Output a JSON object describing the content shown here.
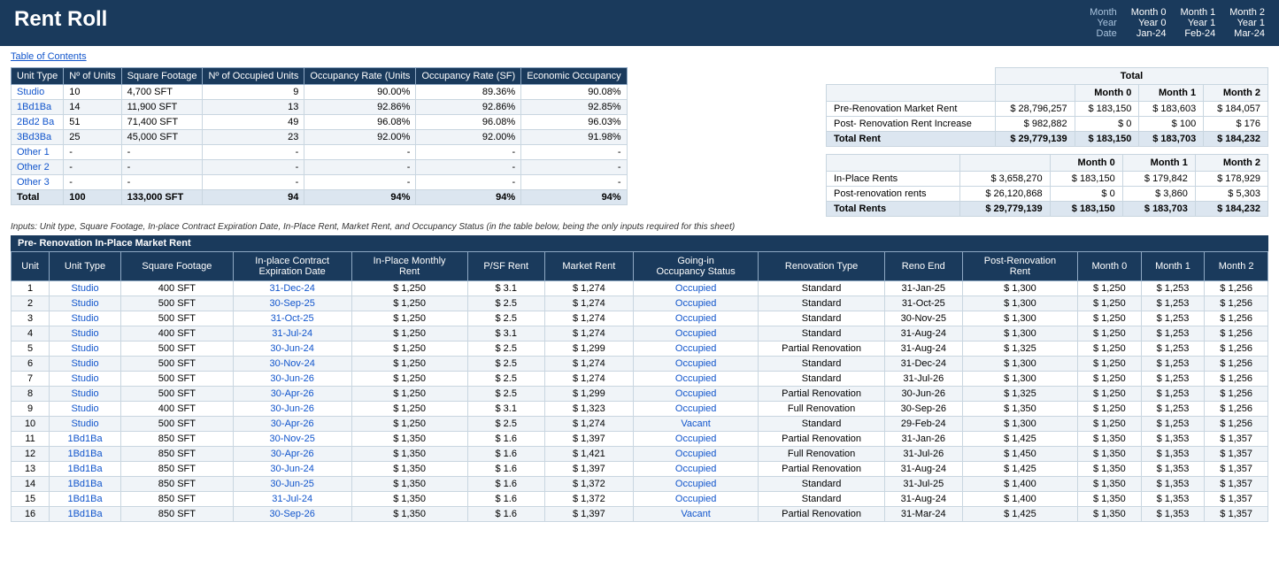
{
  "header": {
    "title": "Rent Roll",
    "col_labels": [
      "Month",
      "Month 0",
      "Month 1",
      "Month 2"
    ],
    "row_year_label": "Year",
    "row_year_vals": [
      "Year 0",
      "Year 1",
      "Year 1"
    ],
    "row_date_label": "Date",
    "row_date_vals": [
      "Jan-24",
      "Feb-24",
      "Mar-24"
    ]
  },
  "toc": "Table of Contents",
  "unit_table": {
    "headers": [
      "Unit Type",
      "Nº of Units",
      "Square Footage",
      "Nº of Occupied Units",
      "Occupancy Rate (Units",
      "Occupancy Rate (SF)",
      "Economic Occupancy"
    ],
    "rows": [
      [
        "Studio",
        "10",
        "4,700 SFT",
        "9",
        "90.00%",
        "89.36%",
        "90.08%"
      ],
      [
        "1Bd1Ba",
        "14",
        "11,900 SFT",
        "13",
        "92.86%",
        "92.86%",
        "92.85%"
      ],
      [
        "2Bd2 Ba",
        "51",
        "71,400 SFT",
        "49",
        "96.08%",
        "96.08%",
        "96.03%"
      ],
      [
        "3Bd3Ba",
        "25",
        "45,000 SFT",
        "23",
        "92.00%",
        "92.00%",
        "91.98%"
      ],
      [
        "Other 1",
        "-",
        "-",
        "-",
        "-",
        "-",
        "-"
      ],
      [
        "Other 2",
        "-",
        "-",
        "-",
        "-",
        "-",
        "-"
      ],
      [
        "Other 3",
        "-",
        "-",
        "-",
        "-",
        "-",
        "-"
      ],
      [
        "Total",
        "100",
        "133,000 SFT",
        "94",
        "94%",
        "94%",
        "94%"
      ]
    ]
  },
  "summary1": {
    "header_total": "Total",
    "col_headers": [
      "",
      "Month 0",
      "Month 1",
      "Month 2"
    ],
    "rows": [
      [
        "Pre-Renovation Market Rent",
        "$ 28,796,257",
        "$ 183,150",
        "$ 183,603",
        "$ 184,057"
      ],
      [
        "Post- Renovation Rent Increase",
        "$ 982,882",
        "$ 0",
        "$ 100",
        "$ 176"
      ],
      [
        "Total Rent",
        "$ 29,779,139",
        "$ 183,150",
        "$ 183,703",
        "$ 184,232"
      ]
    ],
    "total_row_index": 2
  },
  "summary2": {
    "col_headers": [
      "",
      "Month 0",
      "Month 1",
      "Month 2"
    ],
    "rows": [
      [
        "In-Place Rents",
        "$ 3,658,270",
        "$ 183,150",
        "$ 179,842",
        "$ 178,929"
      ],
      [
        "Post-renovation rents",
        "$ 26,120,868",
        "$ 0",
        "$ 3,860",
        "$ 5,303"
      ],
      [
        "Total Rents",
        "$ 29,779,139",
        "$ 183,150",
        "$ 183,703",
        "$ 184,232"
      ]
    ],
    "total_row_index": 2
  },
  "inputs_note": "Inputs: Unit type, Square Footage, In-place Contract Expiration Date, In-Place Rent, Market Rent, and Occupancy Status (in the table below, being the only inputs required for this sheet)",
  "section_label": "Pre- Renovation In-Place Market Rent",
  "detail_table": {
    "headers": [
      "Unit",
      "Unit Type",
      "Square Footage",
      "In-place Contract\nExpiration Date",
      "In-Place Monthly\nRent",
      "P/SF Rent",
      "Market Rent",
      "Going-in\nOccupancy Status",
      "Renovation Type",
      "Reno End",
      "Post-Renovation\nRent",
      "Month 0",
      "Month 1",
      "Month 2"
    ],
    "rows": [
      [
        "1",
        "Studio",
        "400 SFT",
        "31-Dec-24",
        "$ 1,250",
        "$ 3.1",
        "$ 1,274",
        "Occupied",
        "Standard",
        "31-Jan-25",
        "$ 1,300",
        "$ 1,250",
        "$ 1,253",
        "$ 1,256"
      ],
      [
        "2",
        "Studio",
        "500 SFT",
        "30-Sep-25",
        "$ 1,250",
        "$ 2.5",
        "$ 1,274",
        "Occupied",
        "Standard",
        "31-Oct-25",
        "$ 1,300",
        "$ 1,250",
        "$ 1,253",
        "$ 1,256"
      ],
      [
        "3",
        "Studio",
        "500 SFT",
        "31-Oct-25",
        "$ 1,250",
        "$ 2.5",
        "$ 1,274",
        "Occupied",
        "Standard",
        "30-Nov-25",
        "$ 1,300",
        "$ 1,250",
        "$ 1,253",
        "$ 1,256"
      ],
      [
        "4",
        "Studio",
        "400 SFT",
        "31-Jul-24",
        "$ 1,250",
        "$ 3.1",
        "$ 1,274",
        "Occupied",
        "Standard",
        "31-Aug-24",
        "$ 1,300",
        "$ 1,250",
        "$ 1,253",
        "$ 1,256"
      ],
      [
        "5",
        "Studio",
        "500 SFT",
        "30-Jun-24",
        "$ 1,250",
        "$ 2.5",
        "$ 1,299",
        "Occupied",
        "Partial Renovation",
        "31-Aug-24",
        "$ 1,325",
        "$ 1,250",
        "$ 1,253",
        "$ 1,256"
      ],
      [
        "6",
        "Studio",
        "500 SFT",
        "30-Nov-24",
        "$ 1,250",
        "$ 2.5",
        "$ 1,274",
        "Occupied",
        "Standard",
        "31-Dec-24",
        "$ 1,300",
        "$ 1,250",
        "$ 1,253",
        "$ 1,256"
      ],
      [
        "7",
        "Studio",
        "500 SFT",
        "30-Jun-26",
        "$ 1,250",
        "$ 2.5",
        "$ 1,274",
        "Occupied",
        "Standard",
        "31-Jul-26",
        "$ 1,300",
        "$ 1,250",
        "$ 1,253",
        "$ 1,256"
      ],
      [
        "8",
        "Studio",
        "500 SFT",
        "30-Apr-26",
        "$ 1,250",
        "$ 2.5",
        "$ 1,299",
        "Occupied",
        "Partial Renovation",
        "30-Jun-26",
        "$ 1,325",
        "$ 1,250",
        "$ 1,253",
        "$ 1,256"
      ],
      [
        "9",
        "Studio",
        "400 SFT",
        "30-Jun-26",
        "$ 1,250",
        "$ 3.1",
        "$ 1,323",
        "Occupied",
        "Full Renovation",
        "30-Sep-26",
        "$ 1,350",
        "$ 1,250",
        "$ 1,253",
        "$ 1,256"
      ],
      [
        "10",
        "Studio",
        "500 SFT",
        "30-Apr-26",
        "$ 1,250",
        "$ 2.5",
        "$ 1,274",
        "Vacant",
        "Standard",
        "29-Feb-24",
        "$ 1,300",
        "$ 1,250",
        "$ 1,253",
        "$ 1,256"
      ],
      [
        "11",
        "1Bd1Ba",
        "850 SFT",
        "30-Nov-25",
        "$ 1,350",
        "$ 1.6",
        "$ 1,397",
        "Occupied",
        "Partial Renovation",
        "31-Jan-26",
        "$ 1,425",
        "$ 1,350",
        "$ 1,353",
        "$ 1,357"
      ],
      [
        "12",
        "1Bd1Ba",
        "850 SFT",
        "30-Apr-26",
        "$ 1,350",
        "$ 1.6",
        "$ 1,421",
        "Occupied",
        "Full Renovation",
        "31-Jul-26",
        "$ 1,450",
        "$ 1,350",
        "$ 1,353",
        "$ 1,357"
      ],
      [
        "13",
        "1Bd1Ba",
        "850 SFT",
        "30-Jun-24",
        "$ 1,350",
        "$ 1.6",
        "$ 1,397",
        "Occupied",
        "Partial Renovation",
        "31-Aug-24",
        "$ 1,425",
        "$ 1,350",
        "$ 1,353",
        "$ 1,357"
      ],
      [
        "14",
        "1Bd1Ba",
        "850 SFT",
        "30-Jun-25",
        "$ 1,350",
        "$ 1.6",
        "$ 1,372",
        "Occupied",
        "Standard",
        "31-Jul-25",
        "$ 1,400",
        "$ 1,350",
        "$ 1,353",
        "$ 1,357"
      ],
      [
        "15",
        "1Bd1Ba",
        "850 SFT",
        "31-Jul-24",
        "$ 1,350",
        "$ 1.6",
        "$ 1,372",
        "Occupied",
        "Standard",
        "31-Aug-24",
        "$ 1,400",
        "$ 1,350",
        "$ 1,353",
        "$ 1,357"
      ],
      [
        "16",
        "1Bd1Ba",
        "850 SFT",
        "30-Sep-26",
        "$ 1,350",
        "$ 1.6",
        "$ 1,397",
        "Vacant",
        "Partial Renovation",
        "31-Mar-24",
        "$ 1,425",
        "$ 1,350",
        "$ 1,353",
        "$ 1,357"
      ]
    ]
  }
}
